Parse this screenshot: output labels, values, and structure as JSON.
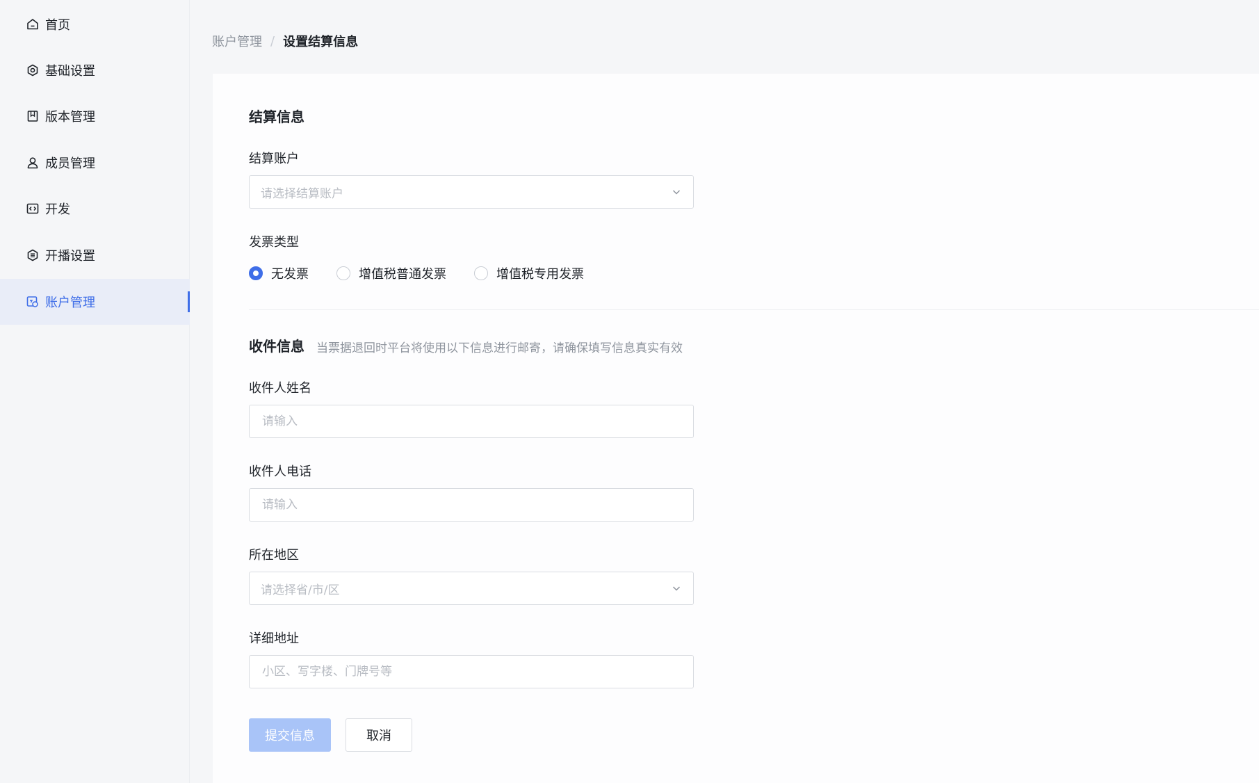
{
  "sidebar": {
    "items": [
      {
        "label": "首页",
        "icon": "home-icon"
      },
      {
        "label": "基础设置",
        "icon": "settings-icon"
      },
      {
        "label": "版本管理",
        "icon": "bookmark-icon"
      },
      {
        "label": "成员管理",
        "icon": "user-icon"
      },
      {
        "label": "开发",
        "icon": "code-icon"
      },
      {
        "label": "开播设置",
        "icon": "broadcast-settings-icon"
      },
      {
        "label": "账户管理",
        "icon": "account-icon",
        "active": true
      }
    ]
  },
  "breadcrumb": {
    "parent": "账户管理",
    "separator": "/",
    "current": "设置结算信息"
  },
  "settlement": {
    "title": "结算信息",
    "account_label": "结算账户",
    "account_placeholder": "请选择结算账户",
    "invoice_label": "发票类型",
    "invoice_options": [
      {
        "label": "无发票",
        "checked": true
      },
      {
        "label": "增值税普通发票",
        "checked": false
      },
      {
        "label": "增值税专用发票",
        "checked": false
      }
    ]
  },
  "recipient": {
    "title": "收件信息",
    "subtitle": "当票据退回时平台将使用以下信息进行邮寄，请确保填写信息真实有效",
    "name_label": "收件人姓名",
    "name_placeholder": "请输入",
    "phone_label": "收件人电话",
    "phone_placeholder": "请输入",
    "region_label": "所在地区",
    "region_placeholder": "请选择省/市/区",
    "address_label": "详细地址",
    "address_placeholder": "小区、写字楼、门牌号等"
  },
  "actions": {
    "submit_label": "提交信息",
    "cancel_label": "取消"
  },
  "colors": {
    "accent": "#3f6ee8",
    "accent_disabled": "#a9c4f8"
  }
}
